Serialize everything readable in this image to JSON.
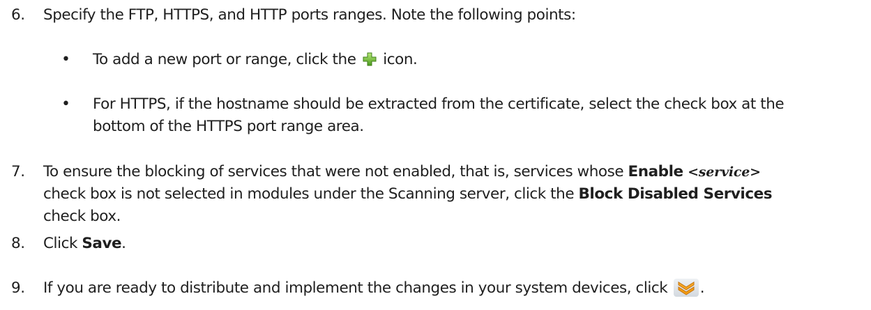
{
  "steps": [
    {
      "number": "6.",
      "text": "Specify the FTP, HTTPS, and HTTP ports ranges. Note the following points:",
      "bullets": [
        {
          "marker": "•",
          "text_before_icon": "To add a new port or range, click the ",
          "icon": "green-plus-icon",
          "text_after_icon": " icon."
        },
        {
          "marker": "•",
          "line1": "For HTTPS, if the hostname should be extracted from the certificate, select the check box at the",
          "line2": "bottom of the HTTPS port range area."
        }
      ]
    },
    {
      "number": "7.",
      "line1_before": "To ensure the blocking of services that were not enabled, that is, services whose ",
      "line1_bold": "Enable",
      "line1_italic": "<service>",
      "line2_before": "check box is not selected in modules under the Scanning server, click the ",
      "line2_bold": "Block Disabled Services",
      "line3": "check box."
    },
    {
      "number": "8.",
      "text_before": "Click ",
      "bold": "Save",
      "text_after": "."
    },
    {
      "number": "9.",
      "text_before_icon": "If you are ready to distribute and implement the changes in your system devices, click ",
      "icon": "orange-double-chevron-icon",
      "text_after_icon": "."
    }
  ]
}
